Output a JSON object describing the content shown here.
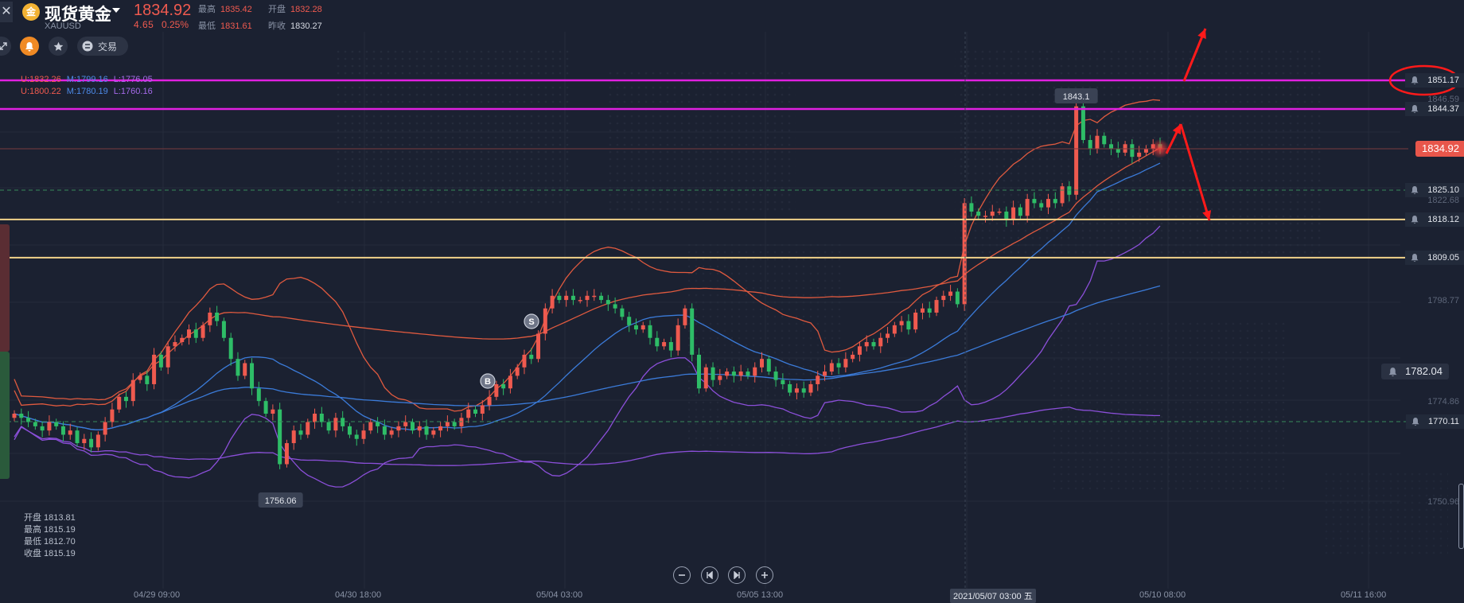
{
  "header": {
    "close_glyph": "✕",
    "coin_glyph": "金",
    "title": "现货黄金",
    "symbol": "XAUUSD",
    "price": "1834.92",
    "change": "4.65",
    "change_pct": "0.25%",
    "high_label": "最高",
    "high": "1835.42",
    "open_label": "开盘",
    "open": "1832.28",
    "low_label": "最低",
    "low": "1831.61",
    "prev_label": "昨收",
    "prev": "1830.27"
  },
  "toolbar": {
    "trade_label": "交易",
    "icons": [
      "expand-icon",
      "bell-icon",
      "star-icon",
      "trade-icon"
    ]
  },
  "legend": {
    "row1": {
      "u": "U:1832.26",
      "m": "M:1799.16",
      "l": "L:1776.05"
    },
    "row2": {
      "u": "U:1800.22",
      "m": "M:1780.19",
      "l": "L:1760.16"
    }
  },
  "ohlc_box": {
    "open_label": "开盘",
    "open": "1813.81",
    "high_label": "最高",
    "high": "1815.19",
    "low_label": "最低",
    "low": "1812.70",
    "close_label": "收盘",
    "close": "1815.19"
  },
  "price_axis": {
    "right_labels": [
      {
        "text": "1851.17",
        "value": 1851.17,
        "kind": "alert"
      },
      {
        "text": "1846.59",
        "value": 1846.59,
        "kind": "faint"
      },
      {
        "text": "1844.37",
        "value": 1844.37,
        "kind": "alert"
      },
      {
        "text": "1834.92",
        "value": 1834.92,
        "kind": "current"
      },
      {
        "text": "1825.10",
        "value": 1825.1,
        "kind": "alert"
      },
      {
        "text": "1822.68",
        "value": 1822.68,
        "kind": "faint"
      },
      {
        "text": "1818.12",
        "value": 1818.12,
        "kind": "alert"
      },
      {
        "text": "1809.05",
        "value": 1809.05,
        "kind": "alert"
      },
      {
        "text": "1798.77",
        "value": 1798.77,
        "kind": "faint"
      },
      {
        "text": "1774.86",
        "value": 1774.86,
        "kind": "faint"
      },
      {
        "text": "1770.11",
        "value": 1770.11,
        "kind": "alert"
      },
      {
        "text": "1750.96",
        "value": 1750.96,
        "kind": "faint"
      }
    ],
    "mid_alert": {
      "text": "1782.04",
      "value": 1782.04
    }
  },
  "x_axis": [
    "04/29 09:00",
    "04/30 18:00",
    "05/04 03:00",
    "05/05 13:00",
    "05/",
    "05/10 08:00",
    "05/11 16:00"
  ],
  "crosshair_label": "2021/05/07 03:00 五",
  "annotations": {
    "peak": "1843.1",
    "trough": "1756.06",
    "marker_b": "B",
    "marker_s": "S"
  },
  "colors": {
    "bg": "#1b2131",
    "up": "#ef5a4f",
    "down": "#2ebd67",
    "upper_band": "#e05a3f",
    "mid_band": "#3b7bd9",
    "lower_band": "#8b4fd9",
    "magenta_line": "#e020e0",
    "gold_line": "#f2d28a"
  },
  "chart_data": {
    "type": "candlestick",
    "ylim": [
      1745,
      1858
    ],
    "horizontal_levels": [
      1851.17,
      1844.37,
      1834.92,
      1825.1,
      1818.12,
      1809.05,
      1770.11
    ],
    "closes": [
      1772,
      1771,
      1770,
      1769,
      1768,
      1770,
      1769,
      1767,
      1768,
      1765,
      1766,
      1764,
      1767,
      1770,
      1773,
      1776,
      1775,
      1780,
      1781,
      1779,
      1786,
      1783,
      1788,
      1789,
      1790,
      1792,
      1790,
      1793,
      1796,
      1794,
      1790,
      1785,
      1781,
      1784,
      1778,
      1775,
      1772,
      1773,
      1760,
      1765,
      1768,
      1767,
      1770,
      1772,
      1770,
      1768,
      1771,
      1769,
      1767,
      1766,
      1768,
      1770,
      1769,
      1767,
      1768,
      1769,
      1770,
      1768,
      1769,
      1767,
      1768,
      1769,
      1770,
      1769,
      1771,
      1773,
      1772,
      1774,
      1776,
      1779,
      1778,
      1781,
      1783,
      1786,
      1785,
      1791,
      1797,
      1800,
      1799,
      1800,
      1799,
      1799,
      1800,
      1800,
      1799,
      1798,
      1797,
      1795,
      1793,
      1792,
      1793,
      1790,
      1788,
      1789,
      1787,
      1793,
      1797,
      1786,
      1778,
      1783,
      1780,
      1781,
      1782,
      1781,
      1782,
      1781,
      1783,
      1785,
      1782,
      1780,
      1779,
      1777,
      1778,
      1777,
      1779,
      1781,
      1782,
      1784,
      1783,
      1785,
      1786,
      1788,
      1789,
      1788,
      1790,
      1791,
      1793,
      1794,
      1792,
      1796,
      1797,
      1796,
      1799,
      1800,
      1801,
      1798,
      1822,
      1820,
      1819,
      1819,
      1820,
      1820,
      1818,
      1821,
      1819,
      1823,
      1822,
      1821,
      1823,
      1822,
      1826,
      1824,
      1845,
      1837,
      1835,
      1838,
      1836,
      1835,
      1834,
      1836,
      1833,
      1834,
      1835,
      1836,
      1834.9
    ]
  }
}
